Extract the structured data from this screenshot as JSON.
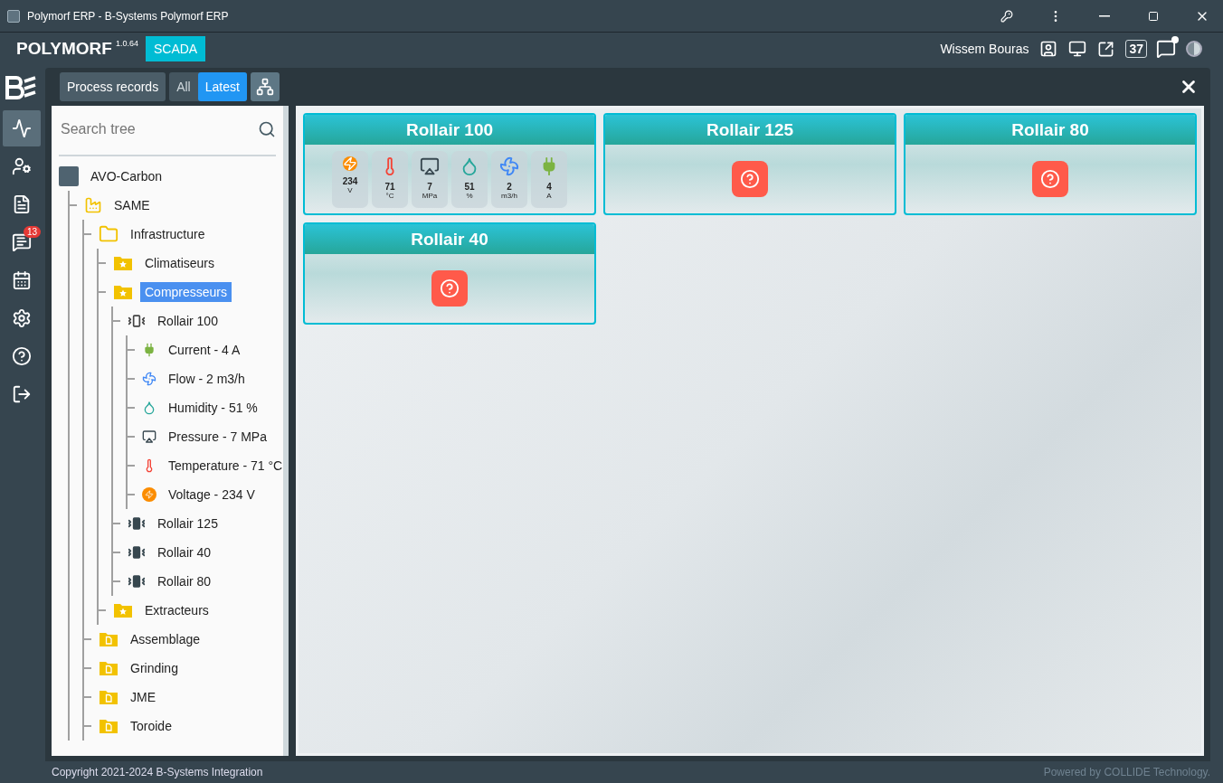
{
  "window": {
    "title": "Polymorf ERP - B-Systems Polymorf ERP"
  },
  "header": {
    "brand": "POLYMORF",
    "version": "1.0.64",
    "module": "SCADA",
    "user": "Wissem Bouras",
    "counter": "37"
  },
  "rail": [
    {
      "kind": "activity",
      "selected": true
    },
    {
      "kind": "users",
      "selected": false
    },
    {
      "kind": "files",
      "selected": false
    },
    {
      "kind": "chat",
      "selected": false,
      "badge": "13"
    },
    {
      "kind": "calendar",
      "selected": false
    },
    {
      "kind": "settings",
      "selected": false
    },
    {
      "kind": "help",
      "selected": false
    },
    {
      "kind": "logout",
      "selected": false
    }
  ],
  "toolbar": {
    "records": "Process records",
    "filters": [
      {
        "label": "All",
        "selected": false
      },
      {
        "label": "Latest",
        "selected": true
      }
    ]
  },
  "tree": {
    "placeholder": "Search tree",
    "nodes": [
      {
        "label": "AVO-Carbon",
        "kind": "company",
        "selected": false,
        "children": [
          {
            "label": "SAME",
            "kind": "plant",
            "selected": false,
            "children": [
              {
                "label": "Infrastructure",
                "kind": "folder",
                "selected": false,
                "children": [
                  {
                    "label": "Climatiseurs",
                    "kind": "starfolder",
                    "selected": false
                  },
                  {
                    "label": "Compresseurs",
                    "kind": "starfolder",
                    "selected": true,
                    "children": [
                      {
                        "label": "Rollair 100",
                        "kind": "device",
                        "selected": false,
                        "children": [
                          {
                            "label": "Current - 4 A",
                            "kind": "current",
                            "selected": false
                          },
                          {
                            "label": "Flow - 2 m3/h",
                            "kind": "flow",
                            "selected": false
                          },
                          {
                            "label": "Humidity - 51 %",
                            "kind": "humidity",
                            "selected": false
                          },
                          {
                            "label": "Pressure - 7 MPa",
                            "kind": "pressure",
                            "selected": false
                          },
                          {
                            "label": "Temperature - 71 °C",
                            "kind": "temperature",
                            "selected": false
                          },
                          {
                            "label": "Voltage - 234 V",
                            "kind": "voltage",
                            "selected": false
                          }
                        ]
                      },
                      {
                        "label": "Rollair 125",
                        "kind": "devicefilled",
                        "selected": false
                      },
                      {
                        "label": "Rollair 40",
                        "kind": "devicefilled",
                        "selected": false
                      },
                      {
                        "label": "Rollair 80",
                        "kind": "devicefilled",
                        "selected": false
                      }
                    ]
                  },
                  {
                    "label": "Extracteurs",
                    "kind": "starfolder",
                    "selected": false
                  }
                ]
              },
              {
                "label": "Assemblage",
                "kind": "docfolder",
                "selected": false
              },
              {
                "label": "Grinding",
                "kind": "docfolder",
                "selected": false
              },
              {
                "label": "JME",
                "kind": "docfolder",
                "selected": false
              },
              {
                "label": "Toroide",
                "kind": "docfolder",
                "selected": false
              }
            ]
          }
        ]
      }
    ]
  },
  "cards": [
    {
      "title": "Rollair 100",
      "kind": "sensors",
      "sensors": [
        {
          "kind": "voltage",
          "value": "234",
          "unit": "V"
        },
        {
          "kind": "temperature",
          "value": "71",
          "unit": "°C"
        },
        {
          "kind": "pressure",
          "value": "7",
          "unit": "MPa"
        },
        {
          "kind": "humidity",
          "value": "51",
          "unit": "%"
        },
        {
          "kind": "flow",
          "value": "2",
          "unit": "m3/h"
        },
        {
          "kind": "current",
          "value": "4",
          "unit": "A"
        }
      ]
    },
    {
      "title": "Rollair 125",
      "kind": "unknown"
    },
    {
      "title": "Rollair 80",
      "kind": "unknown"
    },
    {
      "title": "Rollair 40",
      "kind": "unknown"
    }
  ],
  "footer": {
    "copyright": "Copyright 2021-2024 B-Systems Integration",
    "powered": "Powered by COLLIDE Technology."
  }
}
